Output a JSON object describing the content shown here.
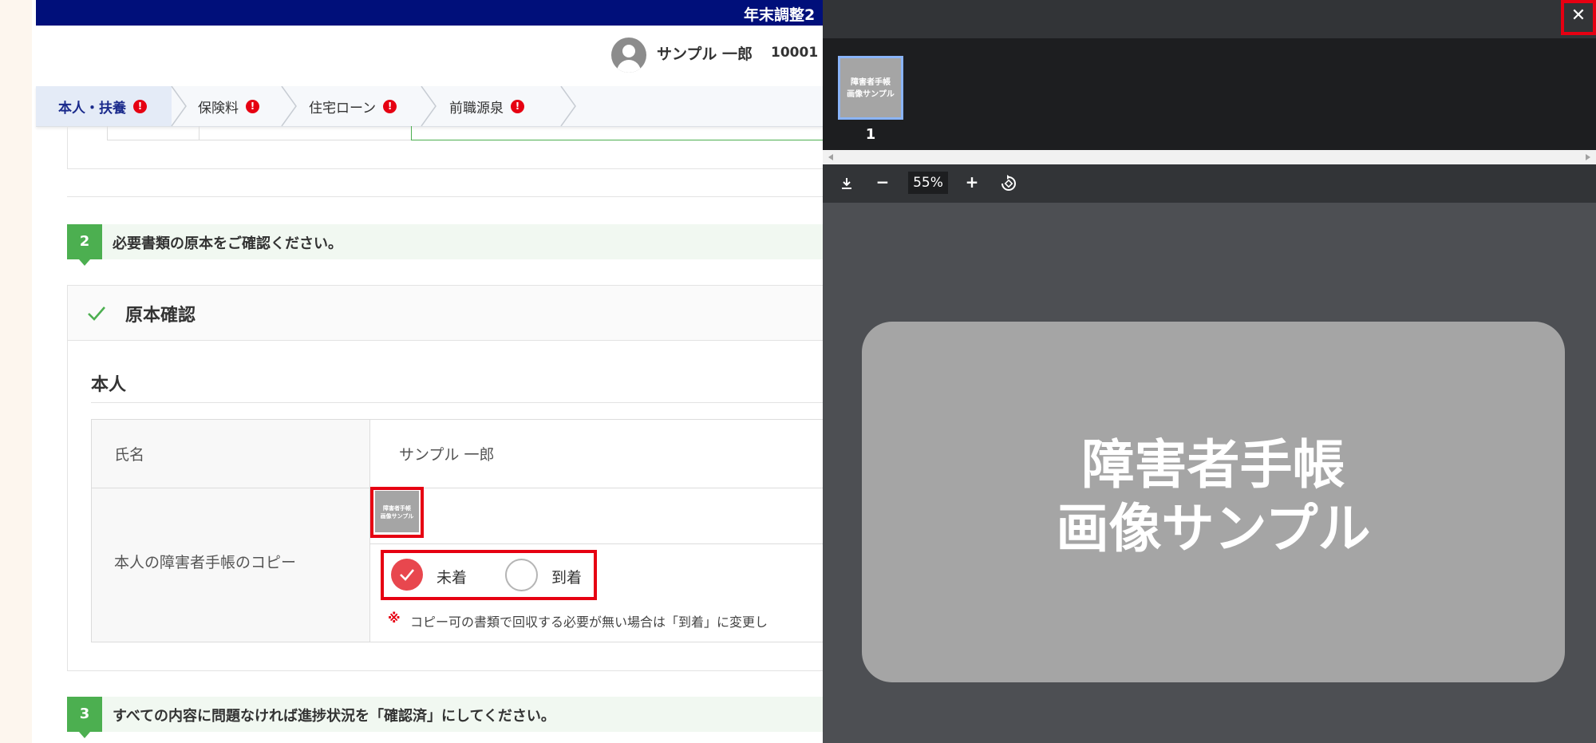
{
  "header": {
    "title": "年末調整2"
  },
  "user": {
    "name": "サンプル 一郎",
    "id": "10001"
  },
  "tabs": [
    {
      "label": "本人・扶養",
      "badge": "!"
    },
    {
      "label": "保険料",
      "badge": "!"
    },
    {
      "label": "住宅ローン",
      "badge": "!"
    },
    {
      "label": "前職源泉",
      "badge": "!"
    }
  ],
  "step2": {
    "num": "2",
    "text": "必要書類の原本をご確認ください。"
  },
  "panel": {
    "title": "原本確認",
    "section": "本人",
    "rows": {
      "name_label": "氏名",
      "name_value": "サンプル 一郎",
      "copy_label": "本人の障害者手帳のコピー"
    },
    "thumb_text": "障害者手帳\n画像サンプル",
    "radio": {
      "option1": "未着",
      "option2": "到着",
      "selected": "未着"
    },
    "note_mark": "※",
    "note": "コピー可の書類で回収する必要が無い場合は「到着」に変更し"
  },
  "step3": {
    "num": "3",
    "text": "すべての内容に問題なければ進捗状況を「確認済」にしてください。"
  },
  "viewer": {
    "close": "✕",
    "page_number": "1",
    "thumb_text": "障害者手帳\n画像サンプル",
    "zoom": "55%",
    "zoom_out": "−",
    "zoom_in": "+",
    "image_line1": "障害者手帳",
    "image_line2": "画像サンプル"
  },
  "colors": {
    "topbar": "#000f7a",
    "accent_green": "#4caf50",
    "alert_red": "#e60012",
    "viewer_bg": "#4d4f53"
  }
}
